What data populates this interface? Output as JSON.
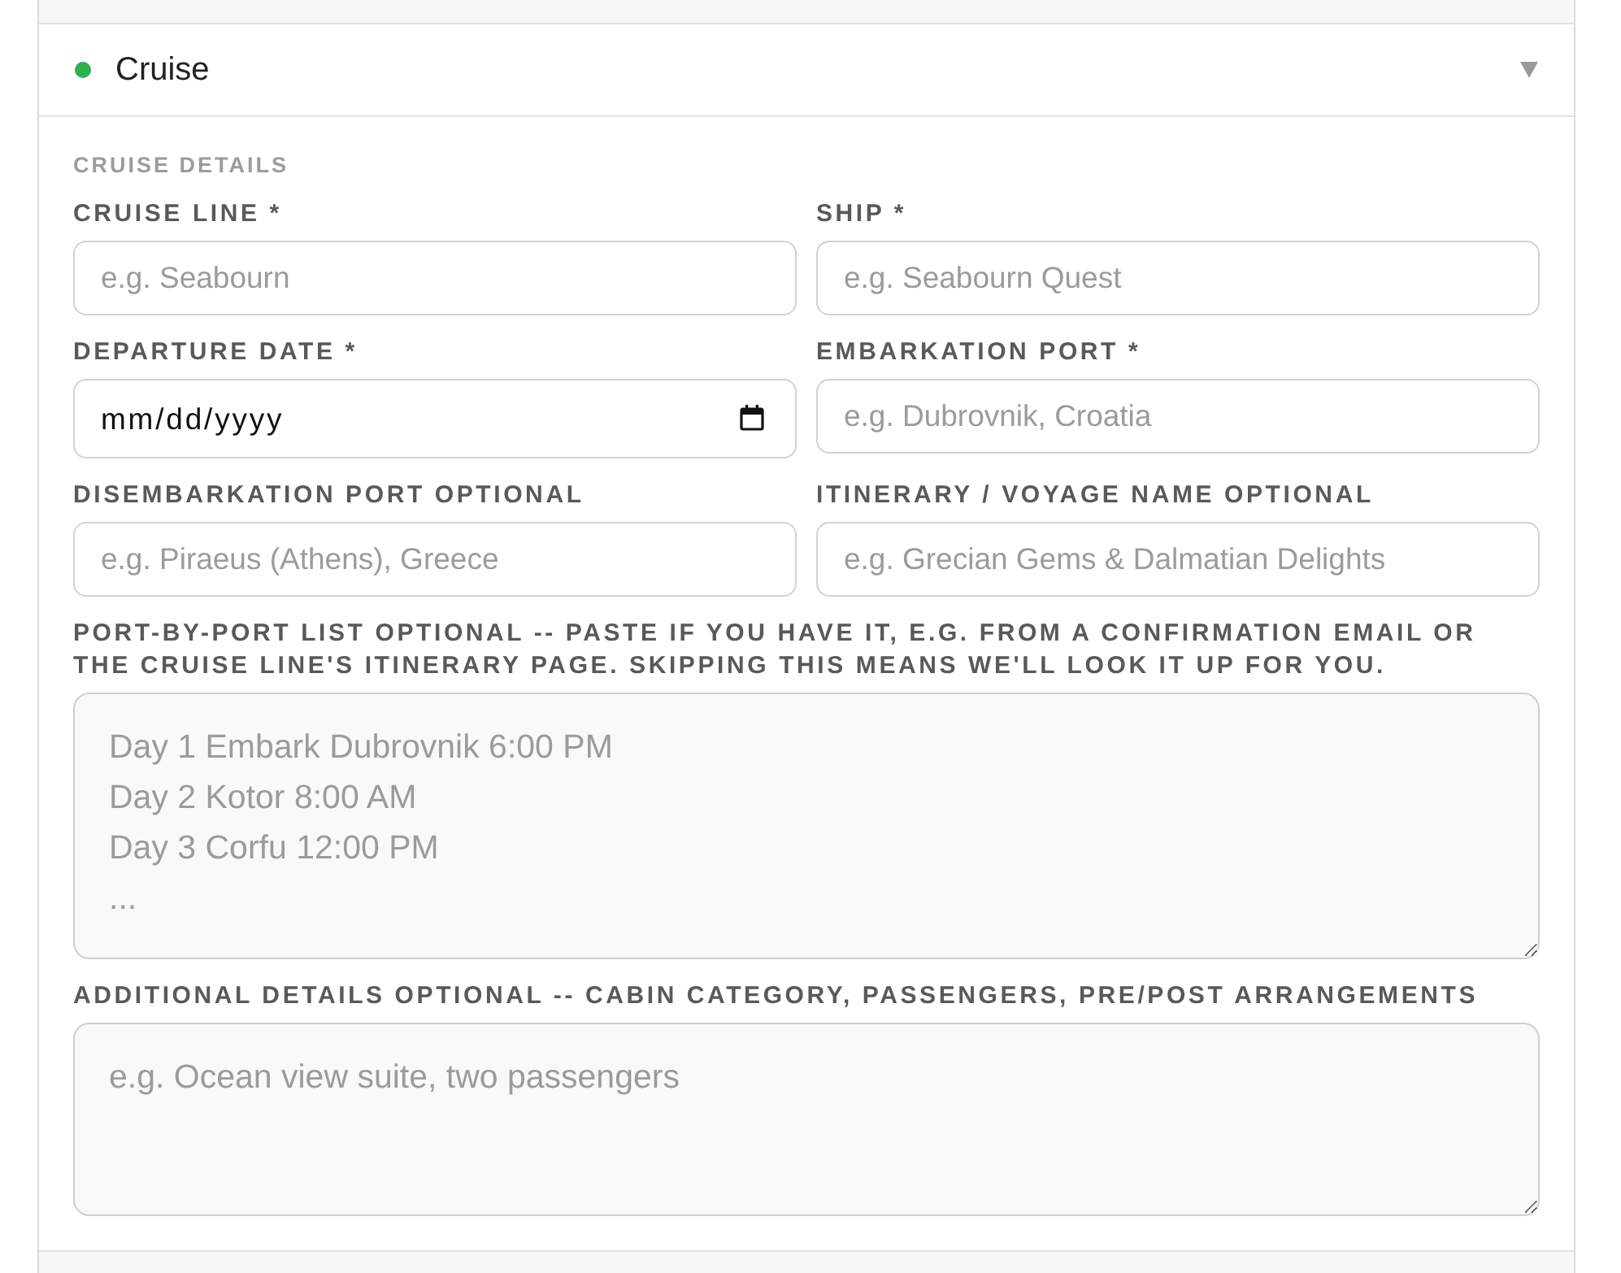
{
  "sections": [
    {
      "title": "Cruise",
      "color": "#2bb24c",
      "expanded": true,
      "heading": "CRUISE DETAILS",
      "fields": [
        {
          "kind": "text",
          "label": "CRUISE LINE *",
          "placeholder": "e.g. Seabourn"
        },
        {
          "kind": "text",
          "label": "SHIP *",
          "placeholder": "e.g. Seabourn Quest"
        },
        {
          "kind": "date",
          "label": "DEPARTURE DATE *",
          "value": "mm/dd/yyyy"
        },
        {
          "kind": "text",
          "label": "EMBARKATION PORT *",
          "placeholder": "e.g. Dubrovnik, Croatia"
        },
        {
          "kind": "text",
          "label": "DISEMBARKATION PORT OPTIONAL",
          "placeholder": "e.g. Piraeus (Athens), Greece"
        },
        {
          "kind": "text",
          "label": "ITINERARY / VOYAGE NAME OPTIONAL",
          "placeholder": "e.g. Grecian Gems & Dalmatian Delights"
        },
        {
          "kind": "textarea",
          "label": "PORT-BY-PORT LIST OPTIONAL -- PASTE IF YOU HAVE IT, E.G. FROM A CONFIRMATION EMAIL OR THE CRUISE LINE'S ITINERARY PAGE. SKIPPING THIS MEANS WE'LL LOOK IT UP FOR YOU.",
          "placeholder": "Day 1 Embark Dubrovnik 6:00 PM\nDay 2 Kotor 8:00 AM\nDay 3 Corfu 12:00 PM\n..."
        },
        {
          "kind": "textarea",
          "label": "ADDITIONAL DETAILS OPTIONAL -- CABIN CATEGORY, PASSENGERS, PRE/POST ARRANGEMENTS",
          "placeholder": "e.g. Ocean view suite, two passengers"
        }
      ]
    }
  ]
}
